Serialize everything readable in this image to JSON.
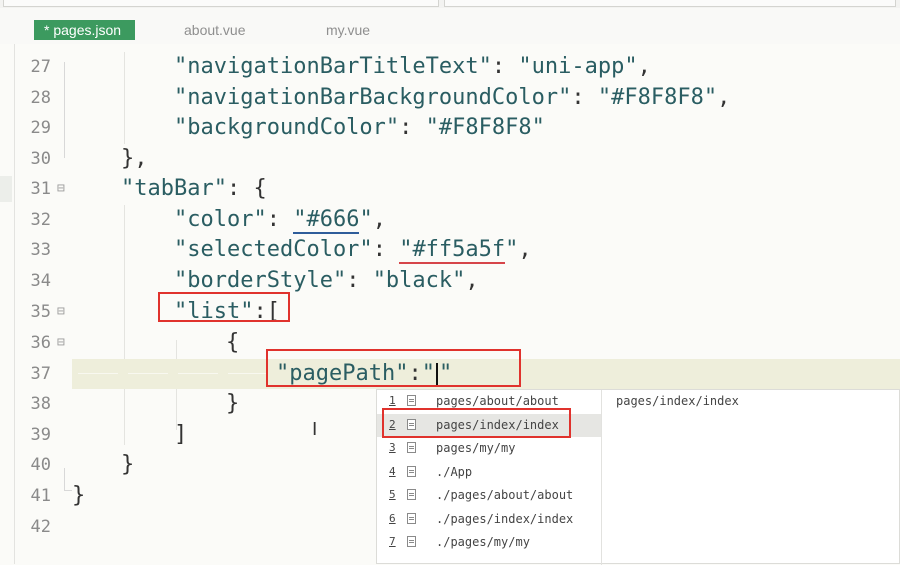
{
  "tabs": [
    {
      "label": "* pages.json",
      "active": true
    },
    {
      "label": "about.vue",
      "active": false
    },
    {
      "label": "my.vue",
      "active": false
    }
  ],
  "line_numbers": [
    "27",
    "28",
    "29",
    "30",
    "31",
    "32",
    "33",
    "34",
    "35",
    "36",
    "37",
    "38",
    "39",
    "40",
    "41",
    "42"
  ],
  "code": {
    "l27": {
      "key": "\"navigationBarTitleText\"",
      "sep": ": ",
      "val": "\"uni-app\"",
      "end": ","
    },
    "l28": {
      "key": "\"navigationBarBackgroundColor\"",
      "sep": ": ",
      "val": "\"#F8F8F8\"",
      "end": ","
    },
    "l29": {
      "key": "\"backgroundColor\"",
      "sep": ": ",
      "val": "\"#F8F8F8\"",
      "end": ""
    },
    "l30": {
      "text": "},"
    },
    "l31": {
      "key": "\"tabBar\"",
      "sep": ": {"
    },
    "l32": {
      "key": "\"color\"",
      "sep": ": ",
      "q1": "\"",
      "val": "#666",
      "q2": "\"",
      "end": ","
    },
    "l33": {
      "key": "\"selectedColor\"",
      "sep": ": ",
      "q1": "\"",
      "val": "#ff5a5f",
      "q2": "\"",
      "end": ","
    },
    "l34": {
      "key": "\"borderStyle\"",
      "sep": ": ",
      "val": "\"black\"",
      "end": ","
    },
    "l35": {
      "key": "\"list\"",
      "sep": ":["
    },
    "l36": {
      "text": "{"
    },
    "l37": {
      "key": "\"pagePath\"",
      "sep": ":",
      "q1": "\"",
      "q2": "\""
    },
    "l38": {
      "text": "}"
    },
    "l39": {
      "text": "]"
    },
    "l40": {
      "text": "}"
    },
    "l41": {
      "text": "}"
    }
  },
  "autocomplete": {
    "items": [
      {
        "num": "1",
        "text": "pages/about/about"
      },
      {
        "num": "2",
        "text": "pages/index/index"
      },
      {
        "num": "3",
        "text": "pages/my/my"
      },
      {
        "num": "4",
        "text": "./App"
      },
      {
        "num": "5",
        "text": "./pages/about/about"
      },
      {
        "num": "6",
        "text": "./pages/index/index"
      },
      {
        "num": "7",
        "text": "./pages/my/my"
      }
    ],
    "selected_index": 1,
    "detail": "pages/index/index"
  },
  "colors": {
    "active_tab": "#3c9a5f",
    "highlight_box": "#e0322d",
    "token": "#2a5d62"
  }
}
